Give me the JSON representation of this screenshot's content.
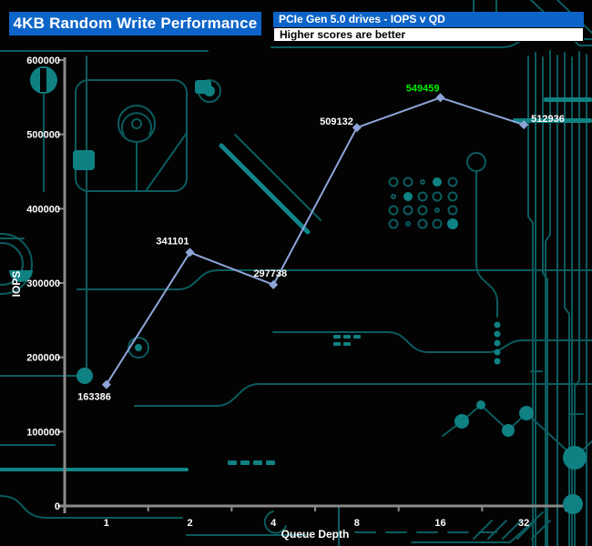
{
  "header": {
    "title": "4KB Random Write Performance",
    "subtitle": "PCIe Gen 5.0 drives - IOPS v QD",
    "note": "Higher scores are better"
  },
  "chart_data": {
    "type": "line",
    "title": "4KB Random Write Performance",
    "subtitle": "PCIe Gen 5.0 drives - IOPS v QD",
    "note": "Higher scores are better",
    "xlabel": "Queue Depth",
    "ylabel": "IOPS",
    "categories": [
      "1",
      "2",
      "4",
      "8",
      "16",
      "32"
    ],
    "values": [
      163386,
      341101,
      297738,
      509132,
      549459,
      512936
    ],
    "ylim": [
      0,
      600000
    ],
    "yticks": [
      0,
      100000,
      200000,
      300000,
      400000,
      500000,
      600000
    ],
    "grid": false,
    "legend_position": "none",
    "marker": "diamond",
    "line_color": "#8fa5da",
    "data_label_color": "#ffffff",
    "highlight": {
      "index": 4,
      "color": "#00ef00"
    },
    "axis_color": "#8a8a8a",
    "tick_label_color": "#ffffff"
  },
  "colors": {
    "background": "#030303",
    "trace": "#0b5b5e",
    "trace_bright": "#0f8588",
    "pad": "#0f8183",
    "header_bg": "#0d64c8",
    "header_text": "#ffffff",
    "note_bg": "#ffffff",
    "note_text": "#000000"
  }
}
